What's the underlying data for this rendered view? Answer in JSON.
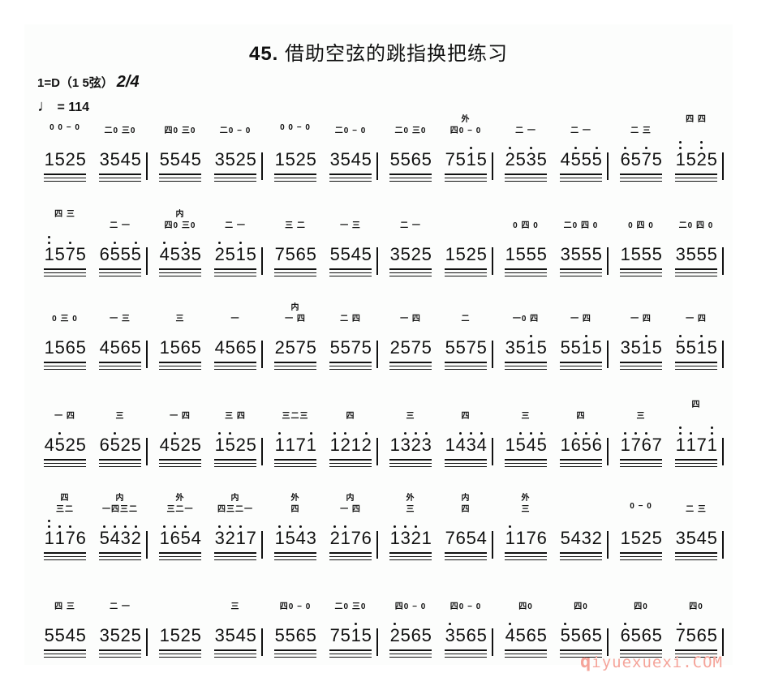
{
  "title": {
    "number": "45.",
    "text": "借助空弦的跳指换把练习"
  },
  "key_signature": "1=D（1 5弦）",
  "time_signature": "2/4",
  "tempo": {
    "note_icon": "quarter-note-icon",
    "text": "= 114"
  },
  "rows": [
    {
      "measures": [
        [
          {
            "digits": "1525",
            "fing": [
              "",
              "0 0 − 0"
            ],
            "dots_above": [],
            "dots_below": []
          },
          {
            "digits": "3545",
            "fing": [
              "",
              "二0 三0"
            ],
            "dots_above": [],
            "dots_below": []
          }
        ],
        [
          {
            "digits": "5545",
            "fing": [
              "",
              "四0 三0"
            ],
            "dots_above": [],
            "dots_below": []
          },
          {
            "digits": "3525",
            "fing": [
              "",
              "二0 − 0"
            ],
            "dots_above": [],
            "dots_below": []
          }
        ],
        [
          {
            "digits": "1525",
            "fing": [
              "",
              "0 0 − 0"
            ],
            "dots_above": [],
            "dots_below": []
          },
          {
            "digits": "3545",
            "fing": [
              "",
              "二0 − 0"
            ],
            "dots_above": [],
            "dots_below": []
          }
        ],
        [
          {
            "digits": "5565",
            "fing": [
              "",
              "二0 三0"
            ],
            "dots_above": [],
            "dots_below": []
          },
          {
            "digits": "7515",
            "fing": [
              "外",
              "四0 − 0"
            ],
            "dots_above": [
              2
            ],
            "dots_below": []
          }
        ],
        [
          {
            "digits": "2535",
            "fing": [
              "",
              "二  一"
            ],
            "dots_above": [
              0,
              2
            ],
            "dots_below": []
          },
          {
            "digits": "4555",
            "fing": [
              "",
              "二  一"
            ],
            "dots_above": [
              1,
              3
            ],
            "dots_below": []
          }
        ],
        [
          {
            "digits": "6575",
            "fing": [
              "",
              "二  三"
            ],
            "dots_above": [
              0,
              2
            ],
            "dots_below": []
          },
          {
            "digits": "1525",
            "fing": [
              "四  四",
              "  "
            ],
            "dots_above": [
              0,
              2
            ],
            "double_dots": [
              0,
              2
            ],
            "dots_below": []
          }
        ]
      ]
    },
    {
      "measures": [
        [
          {
            "digits": "1575",
            "fing": [
              "四 三",
              ""
            ],
            "dots_above": [
              0,
              2
            ],
            "double_dots": [
              0
            ],
            "dots_below": []
          },
          {
            "digits": "6555",
            "fing": [
              "",
              "二  一"
            ],
            "dots_above": [
              1,
              3
            ],
            "dots_below": []
          }
        ],
        [
          {
            "digits": "4535",
            "fing": [
              "内",
              "四0 三0"
            ],
            "dots_above": [
              0,
              2
            ],
            "dots_below": []
          },
          {
            "digits": "2515",
            "fing": [
              "",
              "二  一"
            ],
            "dots_above": [
              0,
              2
            ],
            "dots_below": []
          }
        ],
        [
          {
            "digits": "7565",
            "fing": [
              "",
              "三  二"
            ],
            "dots_above": [],
            "dots_below": []
          },
          {
            "digits": "5545",
            "fing": [
              "",
              "一  三"
            ],
            "dots_above": [],
            "dots_below": []
          }
        ],
        [
          {
            "digits": "3525",
            "fing": [
              "",
              "二  一"
            ],
            "dots_above": [],
            "dots_below": []
          },
          {
            "digits": "1525",
            "fing": [
              "",
              ""
            ],
            "dots_above": [],
            "dots_below": []
          }
        ],
        [
          {
            "digits": "1555",
            "fing": [
              "",
              "0 四 0"
            ],
            "dots_above": [],
            "dots_below": []
          },
          {
            "digits": "3555",
            "fing": [
              "",
              "二0 四 0"
            ],
            "dots_above": [],
            "dots_below": []
          }
        ],
        [
          {
            "digits": "1555",
            "fing": [
              "",
              "0 四 0"
            ],
            "dots_above": [],
            "dots_below": []
          },
          {
            "digits": "3555",
            "fing": [
              "",
              "二0 四 0"
            ],
            "dots_above": [],
            "dots_below": []
          }
        ]
      ]
    },
    {
      "measures": [
        [
          {
            "digits": "1565",
            "fing": [
              "",
              "0 三 0"
            ],
            "dots_above": [],
            "dots_below": []
          },
          {
            "digits": "4565",
            "fing": [
              "",
              "一  三"
            ],
            "dots_above": [],
            "dots_below": []
          }
        ],
        [
          {
            "digits": "1565",
            "fing": [
              "",
              "三"
            ],
            "dots_above": [],
            "dots_below": []
          },
          {
            "digits": "4565",
            "fing": [
              "",
              "一"
            ],
            "dots_above": [],
            "dots_below": []
          }
        ],
        [
          {
            "digits": "2575",
            "fing": [
              "内",
              "一  四"
            ],
            "dots_above": [],
            "dots_below": []
          },
          {
            "digits": "5575",
            "fing": [
              "",
              "二  四"
            ],
            "dots_above": [],
            "dots_below": []
          }
        ],
        [
          {
            "digits": "2575",
            "fing": [
              "",
              "一  四"
            ],
            "dots_above": [],
            "dots_below": []
          },
          {
            "digits": "5575",
            "fing": [
              "",
              "二"
            ],
            "dots_above": [],
            "dots_below": []
          }
        ],
        [
          {
            "digits": "3515",
            "fing": [
              "",
              "一0 四"
            ],
            "dots_above": [
              2
            ],
            "dots_below": []
          },
          {
            "digits": "5515",
            "fing": [
              "",
              "一  四"
            ],
            "dots_above": [
              2
            ],
            "dots_below": []
          }
        ],
        [
          {
            "digits": "3515",
            "fing": [
              "",
              "一  四"
            ],
            "dots_above": [
              2
            ],
            "dots_below": []
          },
          {
            "digits": "5515",
            "fing": [
              "",
              "一  四"
            ],
            "dots_above": [
              0,
              2
            ],
            "dots_below": []
          }
        ]
      ]
    },
    {
      "measures": [
        [
          {
            "digits": "4525",
            "fing": [
              "",
              "一  四"
            ],
            "dots_above": [
              1
            ],
            "dots_below": []
          },
          {
            "digits": "6525",
            "fing": [
              "",
              "三"
            ],
            "dots_above": [
              1
            ],
            "dots_below": []
          }
        ],
        [
          {
            "digits": "4525",
            "fing": [
              "",
              "一  四"
            ],
            "dots_above": [
              1
            ],
            "dots_below": []
          },
          {
            "digits": "1525",
            "fing": [
              "",
              "三  四"
            ],
            "dots_above": [
              0,
              1
            ],
            "dots_below": []
          }
        ],
        [
          {
            "digits": "1171",
            "fing": [
              "",
              "三二三"
            ],
            "dots_above": [
              0,
              3
            ],
            "dots_below": []
          },
          {
            "digits": "1212",
            "fing": [
              "",
              "四"
            ],
            "dots_above": [
              0,
              1,
              3
            ],
            "dots_below": []
          }
        ],
        [
          {
            "digits": "1323",
            "fing": [
              "",
              "三"
            ],
            "dots_above": [
              1,
              2,
              3
            ],
            "dots_below": []
          },
          {
            "digits": "1434",
            "fing": [
              "",
              "四"
            ],
            "dots_above": [
              1,
              2,
              3
            ],
            "dots_below": []
          }
        ],
        [
          {
            "digits": "1545",
            "fing": [
              "",
              "三"
            ],
            "dots_above": [
              1,
              2,
              3
            ],
            "dots_below": []
          },
          {
            "digits": "1656",
            "fing": [
              "",
              "四"
            ],
            "dots_above": [
              1,
              2,
              3
            ],
            "dots_below": []
          }
        ],
        [
          {
            "digits": "1767",
            "fing": [
              "",
              "三"
            ],
            "dots_above": [
              0,
              1,
              2
            ],
            "dots_below": []
          },
          {
            "digits": "1171",
            "fing": [
              "四",
              ""
            ],
            "dots_above": [
              0,
              1,
              3
            ],
            "double_dots": [
              0,
              3
            ],
            "dots_below": []
          }
        ]
      ]
    },
    {
      "measures": [
        [
          {
            "digits": "1176",
            "fing": [
              "四",
              "三二"
            ],
            "dots_above": [
              0,
              1,
              2
            ],
            "double_dots": [
              0
            ],
            "dots_below": []
          },
          {
            "digits": "5432",
            "fing": [
              "内",
              "一四三二"
            ],
            "dots_above": [
              0,
              1,
              2,
              3
            ],
            "dots_below": []
          }
        ],
        [
          {
            "digits": "1654",
            "fing": [
              "外",
              "三二一"
            ],
            "dots_above": [
              0,
              1,
              2
            ],
            "dots_below": []
          },
          {
            "digits": "3217",
            "fing": [
              "内",
              "四三二一"
            ],
            "dots_above": [
              0,
              1,
              2
            ],
            "dots_below": []
          }
        ],
        [
          {
            "digits": "1543",
            "fing": [
              "外",
              "四"
            ],
            "dots_above": [
              0,
              1,
              2
            ],
            "dots_below": []
          },
          {
            "digits": "2176",
            "fing": [
              "内",
              "一 四"
            ],
            "dots_above": [
              0,
              1
            ],
            "dots_below": []
          }
        ],
        [
          {
            "digits": "1321",
            "fing": [
              "外",
              "三"
            ],
            "dots_above": [
              0,
              1,
              2
            ],
            "dots_below": []
          },
          {
            "digits": "7654",
            "fing": [
              "内",
              "四"
            ],
            "dots_above": [],
            "dots_below": []
          }
        ],
        [
          {
            "digits": "1176",
            "fing": [
              "外",
              "三"
            ],
            "dots_above": [
              0
            ],
            "dots_below": []
          },
          {
            "digits": "5432",
            "fing": [
              "",
              ""
            ],
            "dots_above": [],
            "dots_below": []
          }
        ],
        [
          {
            "digits": "1525",
            "fing": [
              "",
              "0 − 0"
            ],
            "dots_above": [],
            "dots_below": []
          },
          {
            "digits": "3545",
            "fing": [
              "",
              "二  三"
            ],
            "dots_above": [],
            "dots_below": []
          }
        ]
      ]
    },
    {
      "measures": [
        [
          {
            "digits": "5545",
            "fing": [
              "",
              "四  三"
            ],
            "dots_above": [],
            "dots_below": []
          },
          {
            "digits": "3525",
            "fing": [
              "",
              "二  一"
            ],
            "dots_above": [],
            "dots_below": []
          }
        ],
        [
          {
            "digits": "1525",
            "fing": [
              "",
              ""
            ],
            "dots_above": [],
            "dots_below": []
          },
          {
            "digits": "3545",
            "fing": [
              "",
              "三"
            ],
            "dots_above": [],
            "dots_below": []
          }
        ],
        [
          {
            "digits": "5565",
            "fing": [
              "",
              "四0 − 0"
            ],
            "dots_above": [],
            "dots_below": []
          },
          {
            "digits": "7515",
            "fing": [
              "",
              "二0 三0"
            ],
            "dots_above": [
              2
            ],
            "dots_below": []
          }
        ],
        [
          {
            "digits": "2565",
            "fing": [
              "",
              "四0 − 0"
            ],
            "dots_above": [
              0
            ],
            "dots_below": []
          },
          {
            "digits": "3565",
            "fing": [
              "",
              "四0 − 0"
            ],
            "dots_above": [
              0
            ],
            "dots_below": []
          }
        ],
        [
          {
            "digits": "4565",
            "fing": [
              "",
              "四0"
            ],
            "dots_above": [
              0
            ],
            "dots_below": []
          },
          {
            "digits": "5565",
            "fing": [
              "",
              "四0"
            ],
            "dots_above": [
              0
            ],
            "dots_below": []
          }
        ],
        [
          {
            "digits": "6565",
            "fing": [
              "",
              "四0"
            ],
            "dots_above": [
              0
            ],
            "dots_below": []
          },
          {
            "digits": "7565",
            "fing": [
              "",
              "四0"
            ],
            "dots_above": [
              0
            ],
            "dots_below": []
          }
        ]
      ]
    }
  ],
  "watermark": {
    "prefix": "q",
    "text": "iyuexuexi.COM"
  }
}
